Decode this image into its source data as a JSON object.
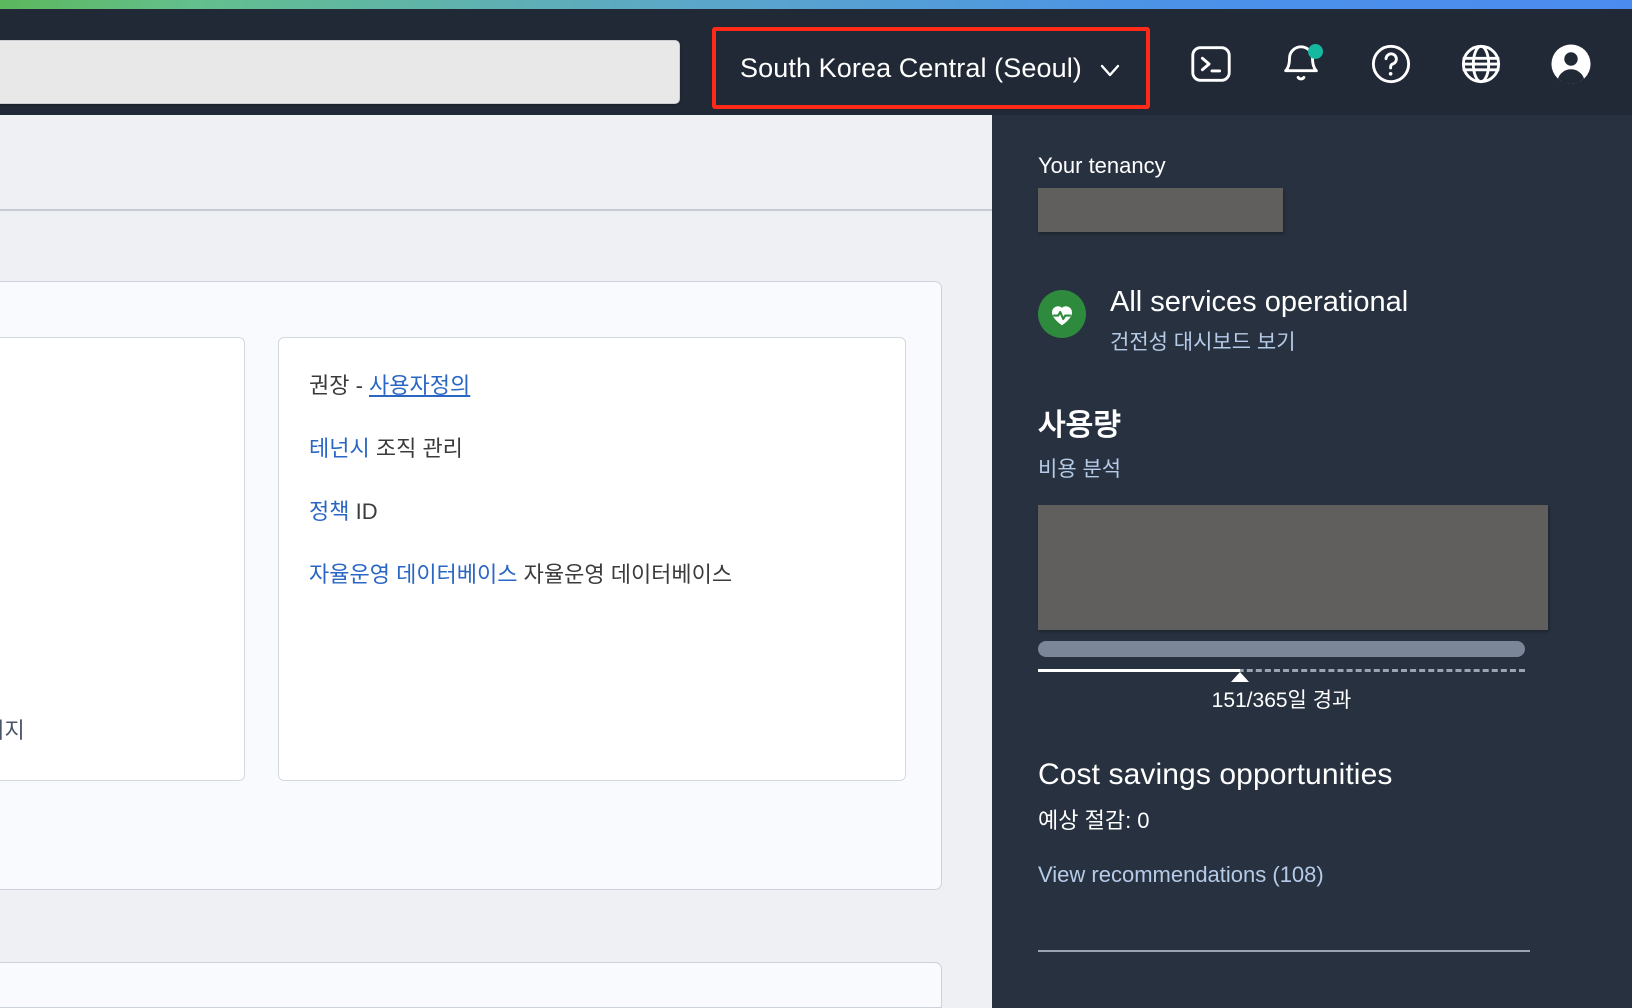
{
  "header": {
    "search": {
      "value": "",
      "placeholder": ""
    },
    "region": {
      "label": "South Korea Central (Seoul)",
      "chevron_icon": "chevron-down-icon"
    },
    "icons": [
      {
        "name": "cloud-shell-icon",
        "title": "Cloud Shell"
      },
      {
        "name": "notifications-bell-icon",
        "title": "Notifications",
        "badge": true
      },
      {
        "name": "help-circle-icon",
        "title": "Help"
      },
      {
        "name": "globe-language-icon",
        "title": "Language"
      },
      {
        "name": "user-avatar-icon",
        "title": "Profile"
      }
    ]
  },
  "main": {
    "left_card": {
      "text": "토리지"
    },
    "right_card": {
      "rows": [
        {
          "prefix": "권장 - ",
          "link": "사용자정의",
          "suffix": "",
          "underline": true
        },
        {
          "prefix": "",
          "link": "테넌시",
          "suffix": " 조직 관리",
          "underline": false
        },
        {
          "prefix": "",
          "link": "정책",
          "suffix": " ID",
          "underline": false
        },
        {
          "prefix": "",
          "link": "자율운영 데이터베이스",
          "suffix": " 자율운영 데이터베이스",
          "underline": false
        }
      ]
    }
  },
  "right_panel": {
    "tenancy_label": "Your tenancy",
    "tenancy_value_redacted": true,
    "health": {
      "status_icon": "health-heart-icon",
      "status_text": "All services operational",
      "dashboard_link": "건전성 대시보드 보기",
      "status_color": "#2e8b3d"
    },
    "usage": {
      "title": "사용량",
      "cost_analysis_link": "비용 분석",
      "chart_redacted": true,
      "progress_caption": "151/365일 경과",
      "progress_percent": 41.4,
      "days_elapsed": 151,
      "days_total": 365
    },
    "cost_savings": {
      "title": "Cost savings opportunities",
      "estimate_label": "예상 절감: 0",
      "recommendations_link": "View recommendations (108)"
    }
  },
  "colors": {
    "header_bg": "#212936",
    "panel_bg": "#27313f",
    "accent_link": "#b6cbe8",
    "main_link": "#2a66c4",
    "highlight_box": "#ff2a17",
    "health_green": "#2e8b3d",
    "badge_teal": "#16b8a0",
    "redaction_gray": "#615f5e"
  }
}
